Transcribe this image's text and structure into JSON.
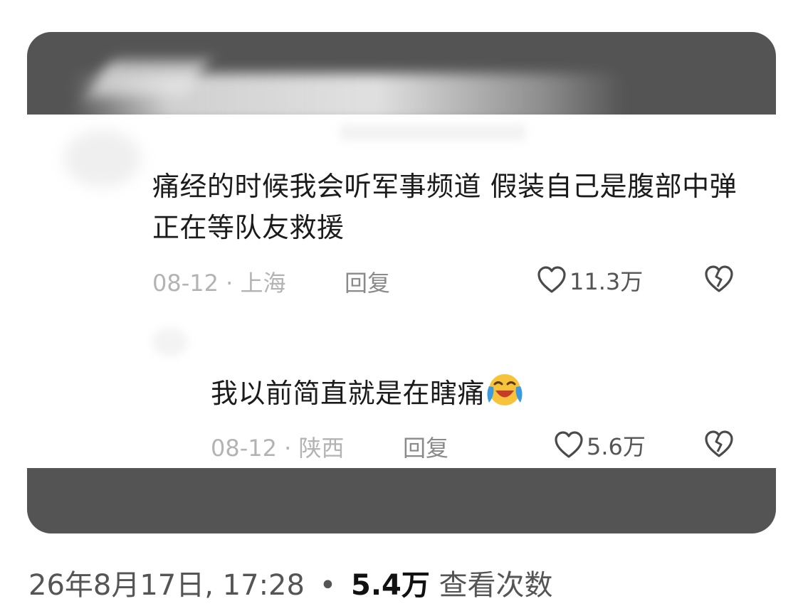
{
  "comments": [
    {
      "text": "痛经的时候我会听军事频道 假装自己是腹部中弹正在等队友救援",
      "date": "08-12",
      "location": "上海",
      "reply_label": "回复",
      "likes": "11.3万"
    },
    {
      "text": "我以前简直就是在瞎痛",
      "emoji": "laughing-crying-emoji",
      "date": "08-12",
      "location": "陕西",
      "reply_label": "回复",
      "likes": "5.6万"
    }
  ],
  "footer": {
    "timestamp": "26年8月17日, 17:28",
    "separator": "•",
    "views": "5.4万",
    "views_label": "查看次数"
  },
  "colors": {
    "card_bg": "#545454",
    "text": "#1b1b1b",
    "meta": "#b3b3b3",
    "emoji_face": "#f6c33b",
    "emoji_tear": "#3c9be0"
  }
}
